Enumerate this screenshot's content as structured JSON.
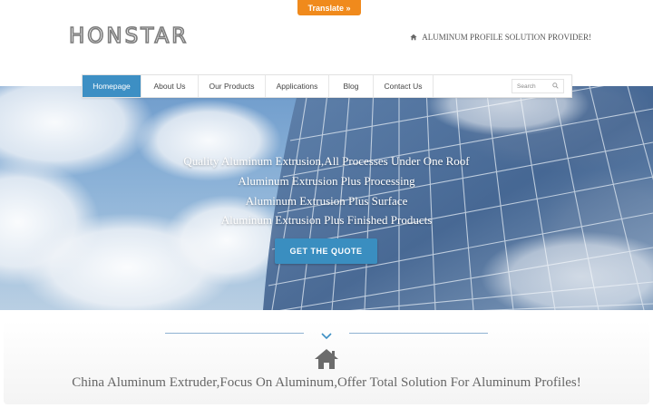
{
  "translate": {
    "label": "Translate »"
  },
  "header": {
    "logo_text": "HONSTAR",
    "tagline": "ALUMINUM PROFILE SOLUTION PROVIDER!"
  },
  "nav": {
    "items": [
      {
        "label": "Homepage",
        "active": true
      },
      {
        "label": "About Us"
      },
      {
        "label": "Our Products"
      },
      {
        "label": "Applications"
      },
      {
        "label": "Blog"
      },
      {
        "label": "Contact Us"
      }
    ],
    "search_placeholder": "Search"
  },
  "hero": {
    "lines": [
      "Quality Aluminum Extrusion,All Processes Under One Roof",
      "Aluminum Extrusion Plus Processing",
      "Aluminum Extrusion Plus Surface",
      "Aluminum Extrusion Plus Finished Products"
    ],
    "cta_label": "GET THE QUOTE"
  },
  "section": {
    "slogan": "China Aluminum Extruder,Focus On Aluminum,Offer Total Solution For Aluminum Profiles!"
  },
  "colors": {
    "accent_blue": "#3d8fc4",
    "translate_orange": "#f08a1c",
    "text_gray": "#666666"
  },
  "icons": [
    "home-icon",
    "search-icon",
    "chevron-down-icon",
    "home-large-icon"
  ]
}
